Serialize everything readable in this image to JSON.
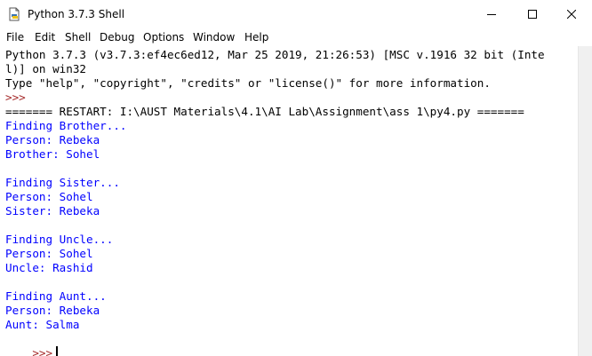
{
  "window": {
    "title": "Python 3.7.3 Shell",
    "icon": "python-file-icon",
    "controls": [
      "minimize-icon",
      "maximize-icon",
      "close-icon"
    ]
  },
  "menu": [
    "File",
    "Edit",
    "Shell",
    "Debug",
    "Options",
    "Window",
    "Help"
  ],
  "colors": {
    "stdout": "#0000ff",
    "prompt": "#a52a2a",
    "default": "#000000"
  },
  "shell": {
    "banner_line1": "Python 3.7.3 (v3.7.3:ef4ec6ed12, Mar 25 2019, 21:26:53) [MSC v.1916 32 bit (Inte",
    "banner_line2": "l)] on win32",
    "banner_line3": "Type \"help\", \"copyright\", \"credits\" or \"license()\" for more information.",
    "prompt": ">>>",
    "restart": "======= RESTART: I:\\AUST Materials\\4.1\\AI Lab\\Assignment\\ass 1\\py4.py =======",
    "output": [
      "Finding Brother...",
      "Person: Rebeka",
      "Brother: Sohel",
      "",
      "Finding Sister...",
      "Person: Sohel",
      "Sister: Rebeka",
      "",
      "Finding Uncle...",
      "Person: Sohel",
      "Uncle: Rashid",
      "",
      "Finding Aunt...",
      "Person: Rebeka",
      "Aunt: Salma"
    ],
    "final_prompt": ">>>"
  }
}
